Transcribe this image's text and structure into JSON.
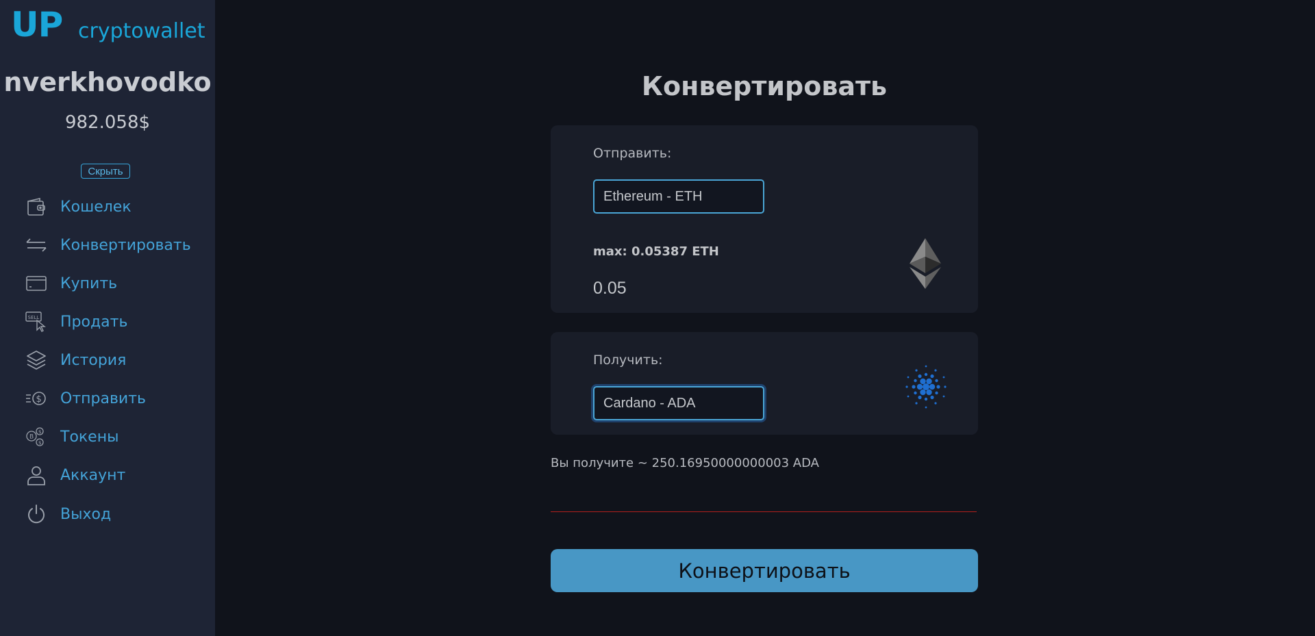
{
  "app": {
    "logo_mark": "UP",
    "logo_text": "cryptowallet"
  },
  "user": {
    "name": "nverkhovodko",
    "balance": "982.058$",
    "hide_label": "Скрыть"
  },
  "sidebar": {
    "items": [
      {
        "label": "Кошелек",
        "icon": "wallet-icon"
      },
      {
        "label": "Конвертировать",
        "icon": "convert-arrows-icon"
      },
      {
        "label": "Купить",
        "icon": "credit-card-icon"
      },
      {
        "label": "Продать",
        "icon": "sell-icon"
      },
      {
        "label": "История",
        "icon": "layers-icon"
      },
      {
        "label": "Отправить",
        "icon": "send-dollar-icon"
      },
      {
        "label": "Токены",
        "icon": "tokens-icon"
      },
      {
        "label": "Аккаунт",
        "icon": "user-icon"
      },
      {
        "label": "Выход",
        "icon": "power-icon"
      }
    ]
  },
  "main": {
    "title": "Конвертировать",
    "send": {
      "label": "Отправить:",
      "selected": "Ethereum - ETH",
      "max": "max: 0.05387 ETH",
      "amount": "0.05",
      "icon": "ethereum-logo-icon"
    },
    "receive": {
      "label": "Получить:",
      "selected": "Cardano - ADA",
      "icon": "cardano-logo-icon"
    },
    "estimate": "Вы получите ~ 250.16950000000003 ADA",
    "convert_button": "Конвертировать"
  },
  "colors": {
    "accent": "#44a3d8",
    "sidebar_bg": "#1e2435",
    "page_bg": "#10131b",
    "card_bg": "#191d28",
    "button_bg": "#4897c5",
    "error_line": "#b3201d"
  }
}
